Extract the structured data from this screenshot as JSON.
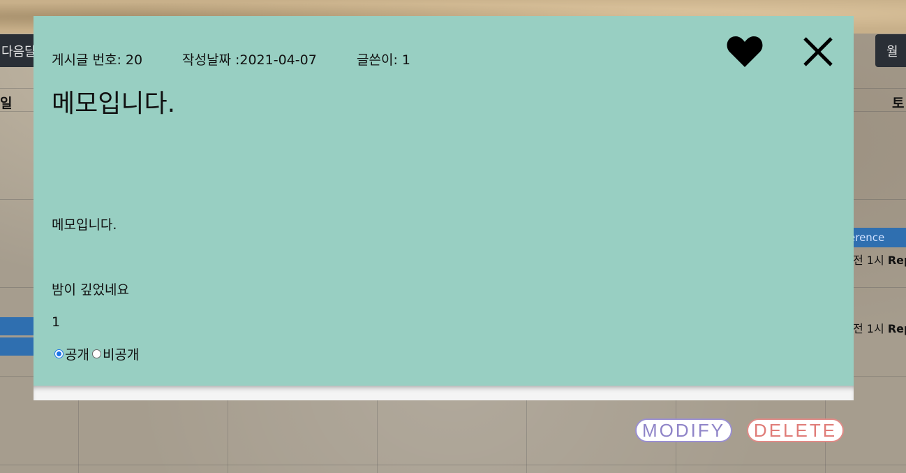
{
  "background": {
    "nav_prev_label": "다음달",
    "nav_right_label": "월",
    "day_left": "일",
    "day_right": "토",
    "event_bar_label": "erence",
    "event_time_1": "전 1시",
    "event_title_1": "Rep",
    "event_time_2": "전 1시",
    "event_title_2": "Rep"
  },
  "modal": {
    "post_number": "게시글 번호: 20",
    "created_date": "작성날짜 :2021-04-07",
    "author": "글쓴이: 1",
    "title": "메모입니다.",
    "body_lines": [
      "메모입니다.",
      "밤이 깊었네요",
      "1"
    ],
    "visibility_options": [
      "공개",
      "비공개"
    ],
    "visibility_selected": "공개",
    "like_icon": "heart-icon",
    "close_icon": "close-icon"
  },
  "actions": {
    "modify_label": "MODIFY",
    "delete_label": "DELETE"
  },
  "colors": {
    "modal_bg": "#98cfc2",
    "modify_accent": "#9a8fd1",
    "delete_accent": "#e08a86",
    "event_bar": "#2f6fb0"
  }
}
